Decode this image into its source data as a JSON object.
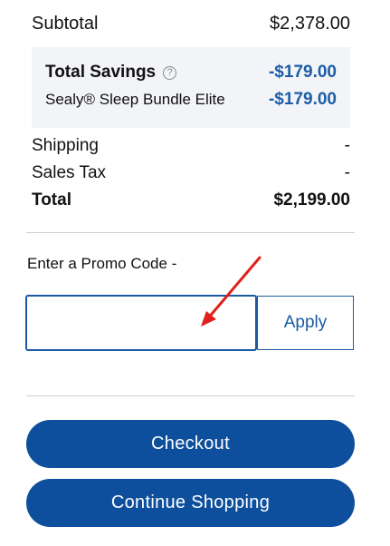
{
  "summary": {
    "subtotal_label": "Subtotal",
    "subtotal_value": "$2,378.00",
    "savings": {
      "title": "Total Savings",
      "title_value": "-$179.00",
      "help_icon": "question-circle-icon",
      "item_label": "Sealy® Sleep Bundle Elite",
      "item_value": "-$179.00"
    },
    "shipping_label": "Shipping",
    "shipping_value": "-",
    "tax_label": "Sales Tax",
    "tax_value": "-",
    "total_label": "Total",
    "total_value": "$2,199.00"
  },
  "promo": {
    "label": "Enter a Promo Code -",
    "input_value": "",
    "placeholder": "",
    "apply_label": "Apply"
  },
  "annotation": {
    "icon": "red-arrow-icon",
    "color": "#e0201b"
  },
  "actions": {
    "checkout_label": "Checkout",
    "continue_label": "Continue Shopping"
  },
  "colors": {
    "accent": "#1a5aa2",
    "button_bg": "#0d4f9c",
    "savings_text": "#1d5da8",
    "savings_bg": "#f3f4f7"
  }
}
